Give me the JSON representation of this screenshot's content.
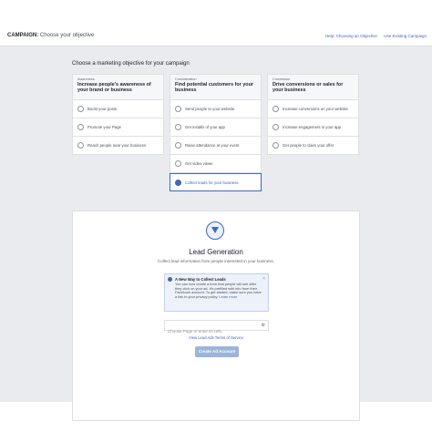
{
  "topbar": {
    "campaign_label": "CAMPAIGN:",
    "campaign_sub": "Choose your objective",
    "links": [
      "Help: Choosing an Objective",
      "Use Existing Campaign"
    ]
  },
  "main": {
    "heading": "Choose a marketing objective for your campaign",
    "columns": [
      {
        "category": "Awareness",
        "title": "Increase people's awareness of your brand or business",
        "items": [
          "Boost your posts",
          "Promote your Page",
          "Reach people near your business"
        ]
      },
      {
        "category": "Consideration",
        "title": "Find potential customers for your business",
        "items": [
          "Send people to your website",
          "Get installs of your app",
          "Raise attendance at your event",
          "Get video views",
          "Collect leads for your business"
        ]
      },
      {
        "category": "Conversion",
        "title": "Drive conversions or sales for your business",
        "items": [
          "Increase conversions on your website",
          "Increase engagement in your app",
          "Get people to claim your offer"
        ]
      }
    ],
    "selected_item": "Collect leads for your business"
  },
  "lead_gen": {
    "title": "Lead Generation",
    "subtitle": "Collect lead information from people interested in your business.",
    "info_title": "A New Way to Collect Leads",
    "info_text": "You can now create a form that people will see after they click on your ad. It's prefilled with info from their Facebook account. To get started, make sure you have a link to your privacy policy.",
    "info_link": "Learn more",
    "page_placeholder": "Choose Page or enter its URL",
    "terms_link": "View Lead Ads Terms of Service",
    "create_button": "Create Ad Account"
  },
  "colors": {
    "accent": "#4267b2",
    "background": "#e9ebee"
  }
}
